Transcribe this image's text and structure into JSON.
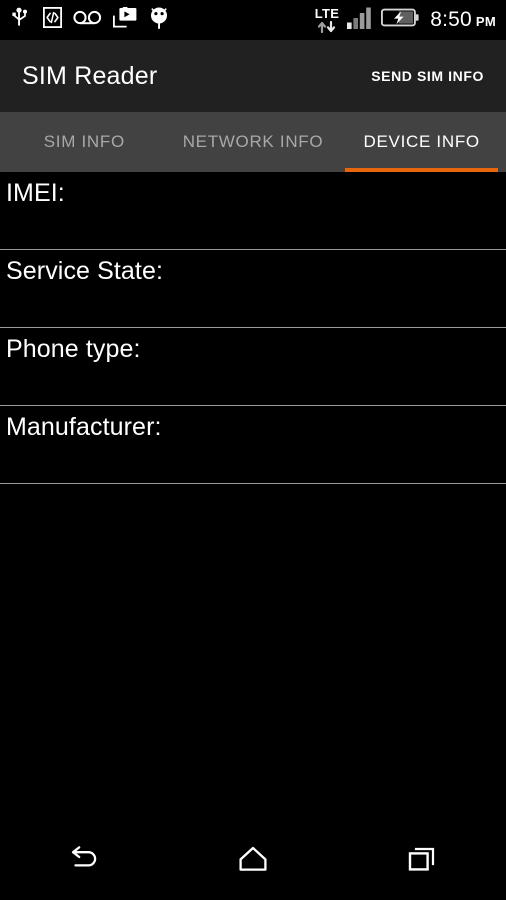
{
  "status_bar": {
    "icons_left": [
      {
        "name": "usb-icon",
        "label": "USB connected"
      },
      {
        "name": "developer-mode-icon",
        "label": "Developer options"
      },
      {
        "name": "voicemail-icon",
        "label": "Voicemail"
      },
      {
        "name": "cast-media-icon",
        "label": "Media cast"
      },
      {
        "name": "android-robot-icon",
        "label": "Android system"
      }
    ],
    "network_type": "LTE",
    "signal_bars": 4,
    "signal_filled": 3,
    "battery_state": "charging",
    "time": "8:50",
    "ampm": "PM"
  },
  "app_bar": {
    "title": "SIM Reader",
    "action_label": "SEND SIM INFO"
  },
  "tabs": [
    {
      "label": "SIM INFO",
      "active": false
    },
    {
      "label": "NETWORK INFO",
      "active": false
    },
    {
      "label": "DEVICE INFO",
      "active": true
    }
  ],
  "device_info_rows": [
    {
      "label": "IMEI:",
      "value": ""
    },
    {
      "label": "Service State:",
      "value": ""
    },
    {
      "label": "Phone type:",
      "value": ""
    },
    {
      "label": "Manufacturer:",
      "value": ""
    }
  ],
  "nav_bar": [
    {
      "name": "back-button",
      "label": "Back"
    },
    {
      "name": "home-button",
      "label": "Home"
    },
    {
      "name": "recents-button",
      "label": "Recent apps"
    }
  ],
  "colors": {
    "accent": "#e8650d",
    "app_bar_bg": "#212121",
    "tab_bar_bg": "#424242",
    "screen_bg": "#000000",
    "divider": "#9a9a9a",
    "tab_inactive_text": "#a8a8a8"
  }
}
